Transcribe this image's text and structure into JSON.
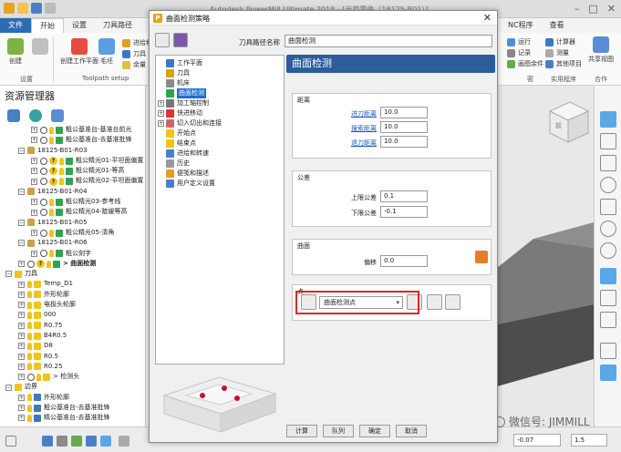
{
  "app": {
    "window_title": "Autodesk PowerMill Ultimate 2018 - [示范零件（18125-B01）]",
    "tabs": [
      "文件",
      "开始",
      "设置",
      "刀具路径",
      "刀具",
      "边界",
      "参考线",
      "特征",
      "查看"
    ],
    "tab_right": "NC程序",
    "tab_right2": "查看",
    "ribbon": {
      "create": "创建",
      "setup_group": "设置",
      "create_workplane": "创建工作平面",
      "blank": "毛坯",
      "advance_link": "进给和",
      "tool": "刀具",
      "stock": "余量",
      "toolpath_setup": "Toolpath setup",
      "run": "运行",
      "record": "记录",
      "paint": "画图余件",
      "calculator": "计算器",
      "measure": "测量",
      "other": "其他项目",
      "utility": "实用程序",
      "share_view": "共享视图",
      "collab": "合作",
      "group_mid": "密"
    },
    "colors": {
      "accent": "#2b6cb5",
      "panel_header": "#2a5d99",
      "highlight_box": "#e02424"
    }
  },
  "explorer": {
    "title": "资源管理器",
    "tree": [
      {
        "indent": 2,
        "label": "粗公基准台-基准台前光",
        "kind": "toolpath"
      },
      {
        "indent": 2,
        "label": "粗公基准台-去基准批锋",
        "kind": "toolpath"
      },
      {
        "indent": 1,
        "label": "18125-B01-R03",
        "kind": "folder"
      },
      {
        "indent": 2,
        "label": "粗公精光01-平坦面偏置",
        "kind": "toolpath-q"
      },
      {
        "indent": 2,
        "label": "粗公精光01-等高",
        "kind": "toolpath-q"
      },
      {
        "indent": 2,
        "label": "粗公精光02-平坦面偏置",
        "kind": "toolpath-q"
      },
      {
        "indent": 1,
        "label": "18125-B01-R04",
        "kind": "folder"
      },
      {
        "indent": 2,
        "label": "粗公精光03-参考线",
        "kind": "toolpath"
      },
      {
        "indent": 2,
        "label": "粗公精光04-陡缓等高",
        "kind": "toolpath"
      },
      {
        "indent": 1,
        "label": "18125-B01-R05",
        "kind": "folder"
      },
      {
        "indent": 2,
        "label": "粗公精光05-清角",
        "kind": "toolpath"
      },
      {
        "indent": 1,
        "label": "18125-B01-R06",
        "kind": "folder"
      },
      {
        "indent": 2,
        "label": "粗公刻字",
        "kind": "toolpath"
      },
      {
        "indent": 1,
        "label": "> 曲面检测",
        "kind": "current"
      },
      {
        "indent": 0,
        "label": "刀具",
        "kind": "section"
      },
      {
        "indent": 1,
        "label": "Temp_D1",
        "kind": "tool"
      },
      {
        "indent": 1,
        "label": "外形轮廓",
        "kind": "tool"
      },
      {
        "indent": 1,
        "label": "电极头轮廓",
        "kind": "tool"
      },
      {
        "indent": 1,
        "label": "000",
        "kind": "tool"
      },
      {
        "indent": 1,
        "label": "R0.75",
        "kind": "tool"
      },
      {
        "indent": 1,
        "label": "B4R0.5",
        "kind": "tool"
      },
      {
        "indent": 1,
        "label": "D8",
        "kind": "tool"
      },
      {
        "indent": 1,
        "label": "R0.5",
        "kind": "tool"
      },
      {
        "indent": 1,
        "label": "R0.25",
        "kind": "tool"
      },
      {
        "indent": 1,
        "label": "> 检测头",
        "kind": "tool-current"
      },
      {
        "indent": 0,
        "label": "边界",
        "kind": "section"
      },
      {
        "indent": 1,
        "label": "外形轮廓",
        "kind": "boundary"
      },
      {
        "indent": 1,
        "label": "粗公基准台-去基准批锋",
        "kind": "boundary"
      },
      {
        "indent": 1,
        "label": "精公基准台-去基准批锋",
        "kind": "boundary"
      }
    ]
  },
  "status": {
    "field1": "-0.07",
    "field2": "1.5"
  },
  "dialog": {
    "title": "曲面检测策略",
    "toolpath_name_label": "刀具路径名称",
    "toolpath_name_value": "曲面检测",
    "tree": [
      {
        "indent": 0,
        "label": "工作平面",
        "pm": ""
      },
      {
        "indent": 0,
        "label": "刀具",
        "pm": ""
      },
      {
        "indent": 0,
        "label": "机床",
        "pm": ""
      },
      {
        "indent": 0,
        "label": "曲面检测",
        "pm": "",
        "selected": true
      },
      {
        "indent": 0,
        "label": "加工轴控制",
        "pm": "+"
      },
      {
        "indent": 0,
        "label": "快进移动",
        "pm": "+"
      },
      {
        "indent": 0,
        "label": "切入切出和连接",
        "pm": "+"
      },
      {
        "indent": 0,
        "label": "开始点",
        "pm": ""
      },
      {
        "indent": 0,
        "label": "结束点",
        "pm": ""
      },
      {
        "indent": 0,
        "label": "进给和转速",
        "pm": ""
      },
      {
        "indent": 0,
        "label": "历史",
        "pm": ""
      },
      {
        "indent": 0,
        "label": "便笺和描述",
        "pm": ""
      },
      {
        "indent": 0,
        "label": "用户定义设置",
        "pm": ""
      }
    ],
    "panel_title": "曲面检测",
    "distance": {
      "title": "距离",
      "approach_label": "进刀距离",
      "approach_value": "10.0",
      "search_label": "搜索距离",
      "search_value": "10.0",
      "retract_label": "退刀距离",
      "retract_value": "10.0"
    },
    "tolerance": {
      "title": "公差",
      "upper_label": "上限公差",
      "upper_value": "0.1",
      "lower_label": "下限公差",
      "lower_value": "-0.1"
    },
    "surface": {
      "title": "曲面",
      "offset_label": "偏移",
      "offset_value": "0.0"
    },
    "points": {
      "title": "点",
      "select_value": "曲面检测点"
    },
    "buttons": {
      "calculate": "计算",
      "queue": "队列",
      "ok": "确定",
      "cancel": "取消"
    }
  },
  "watermark": "微信号: JIMMILL"
}
